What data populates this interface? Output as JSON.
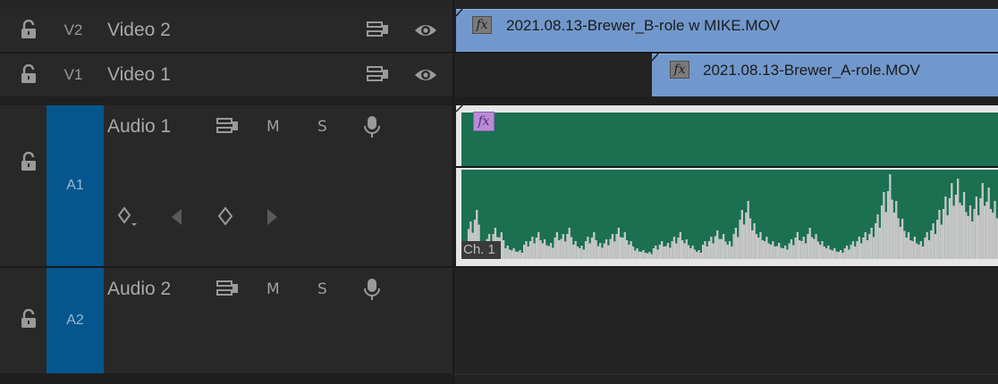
{
  "tracks": {
    "v2": {
      "id": "V2",
      "name": "Video 2"
    },
    "v1": {
      "id": "V1",
      "name": "Video 1"
    },
    "a1": {
      "id": "A1",
      "name": "Audio 1",
      "mute": "M",
      "solo": "S"
    },
    "a2": {
      "id": "A2",
      "name": "Audio 2",
      "mute": "M",
      "solo": "S"
    }
  },
  "clips": {
    "v2_clip": {
      "name": "2021.08.13-Brewer_B-role w MIKE.MOV",
      "fx": "fx"
    },
    "v1_clip": {
      "name": "2021.08.13-Brewer_A-role.MOV",
      "fx": "fx"
    },
    "a1_clip": {
      "fx": "fx",
      "channel": "Ch. 1"
    }
  },
  "colors": {
    "video_clip": "#7198cc",
    "audio_clip": "#1a7050",
    "track_target_blue": "#05568f",
    "waveform": "#c8c8c8"
  },
  "waveform_levels": [
    0.18,
    0.42,
    0.55,
    0.2,
    0.28,
    0.35,
    0.3,
    0.15,
    0.12,
    0.1,
    0.2,
    0.25,
    0.3,
    0.22,
    0.18,
    0.3,
    0.28,
    0.35,
    0.2,
    0.15,
    0.25,
    0.3,
    0.18,
    0.22,
    0.28,
    0.35,
    0.3,
    0.2,
    0.12,
    0.1,
    0.08,
    0.15,
    0.2,
    0.18,
    0.25,
    0.3,
    0.22,
    0.15,
    0.1,
    0.2,
    0.25,
    0.32,
    0.28,
    0.2,
    0.35,
    0.55,
    0.65,
    0.4,
    0.3,
    0.25,
    0.2,
    0.18,
    0.15,
    0.22,
    0.3,
    0.25,
    0.35,
    0.28,
    0.2,
    0.15,
    0.12,
    0.1,
    0.15,
    0.2,
    0.25,
    0.3,
    0.35,
    0.5,
    0.75,
    0.95,
    0.65,
    0.45,
    0.3,
    0.25,
    0.2,
    0.3,
    0.4,
    0.55,
    0.7,
    0.85,
    0.9,
    0.75,
    0.6,
    0.7,
    0.85,
    0.8,
    0.65
  ]
}
